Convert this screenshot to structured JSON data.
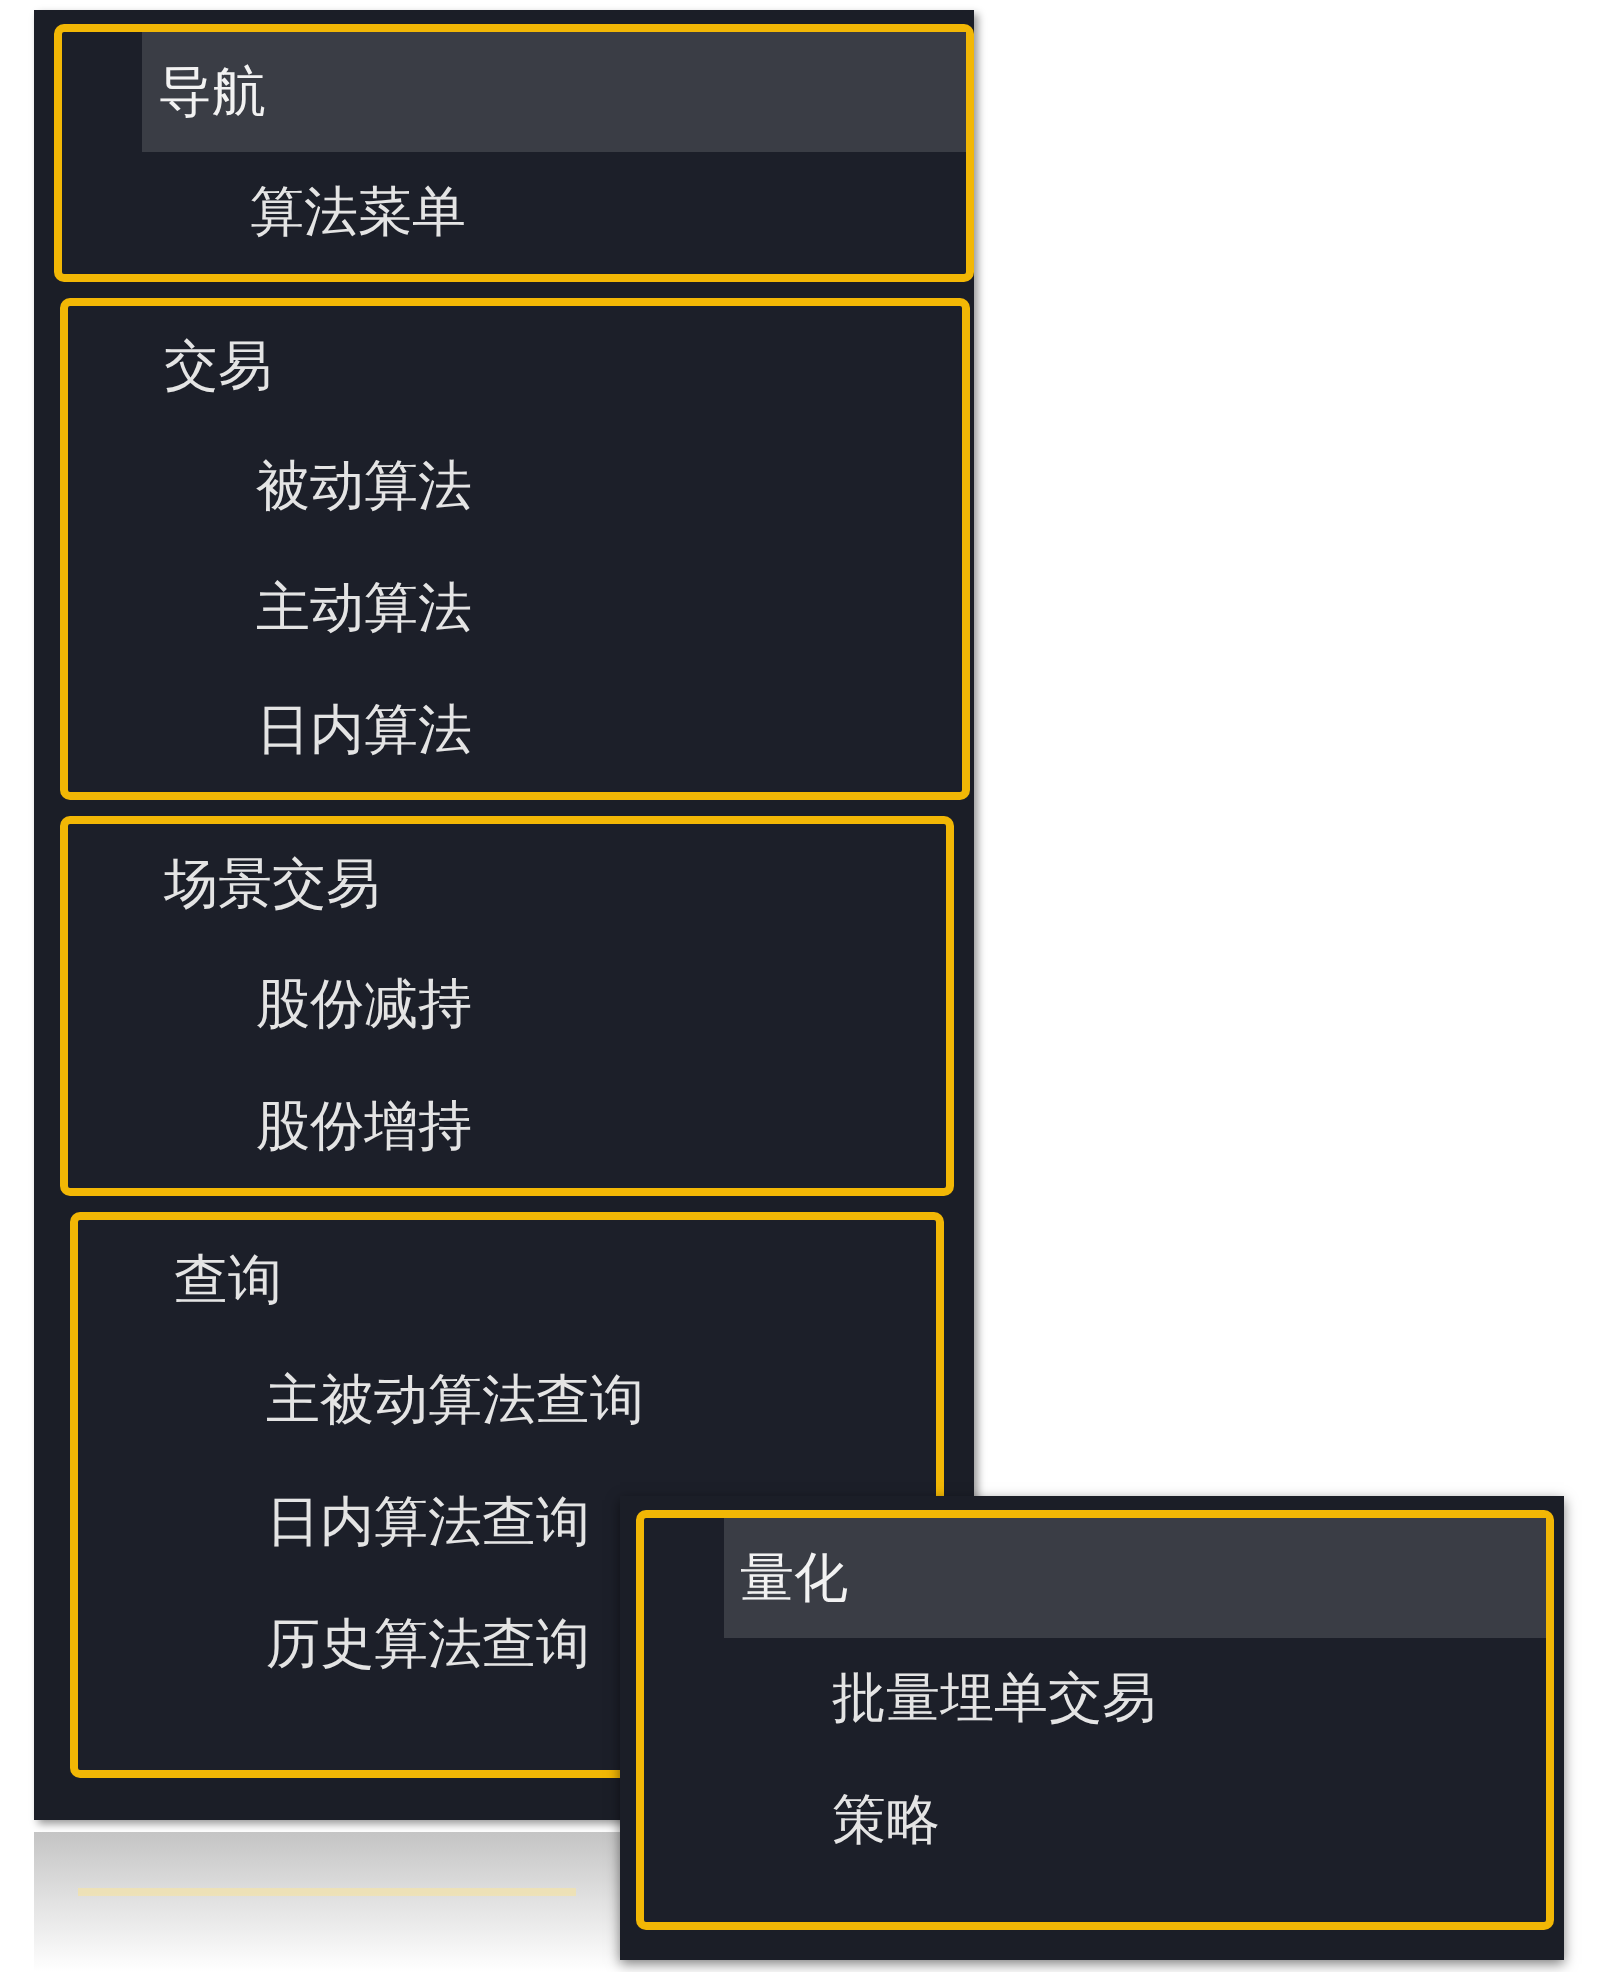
{
  "menu": {
    "groups": [
      {
        "title": "导航",
        "highlighted": true,
        "items": [
          "算法菜单"
        ]
      },
      {
        "title": "交易",
        "highlighted": false,
        "items": [
          "被动算法",
          "主动算法",
          "日内算法"
        ]
      },
      {
        "title": "场景交易",
        "highlighted": false,
        "items": [
          "股份减持",
          "股份增持"
        ]
      },
      {
        "title": "查询",
        "highlighted": false,
        "items": [
          "主被动算法查询",
          "日内算法查询",
          "历史算法查询"
        ]
      }
    ]
  },
  "popup": {
    "groups": [
      {
        "title": "量化",
        "highlighted": true,
        "items": [
          "批量埋单交易",
          "策略"
        ]
      }
    ]
  }
}
